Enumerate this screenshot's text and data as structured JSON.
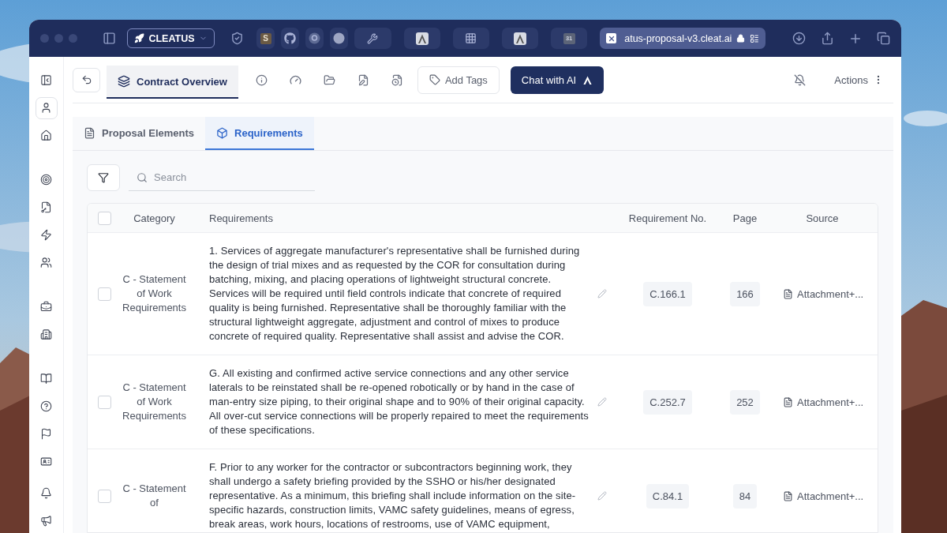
{
  "browser": {
    "profile": "CLEATUS",
    "tabs": [
      {
        "kind": "letter",
        "text": "S"
      },
      {
        "kind": "github"
      },
      {
        "kind": "p-circle"
      },
      {
        "kind": "dot"
      },
      {
        "kind": "tool"
      },
      {
        "kind": "logo"
      },
      {
        "kind": "grid"
      },
      {
        "kind": "logo"
      },
      {
        "kind": "calendar",
        "text": "31"
      }
    ],
    "address": "atus-proposal-v3.cleat.ai"
  },
  "sidebar": {
    "items": [
      {
        "kind": "panel",
        "selected": false
      },
      {
        "kind": "user",
        "selected": true
      },
      {
        "kind": "home",
        "selected": false
      },
      {
        "kind": "gap"
      },
      {
        "kind": "target",
        "selected": false
      },
      {
        "kind": "file-key",
        "selected": false
      },
      {
        "kind": "zap",
        "selected": false
      },
      {
        "kind": "users",
        "selected": false
      },
      {
        "kind": "gap"
      },
      {
        "kind": "briefcase",
        "selected": false
      },
      {
        "kind": "building",
        "selected": false
      },
      {
        "kind": "gap"
      },
      {
        "kind": "book",
        "selected": false
      },
      {
        "kind": "help",
        "selected": false
      },
      {
        "kind": "flag",
        "selected": false
      },
      {
        "kind": "card",
        "selected": false
      }
    ],
    "bottom": [
      {
        "kind": "bell",
        "selected": false
      },
      {
        "kind": "megaphone",
        "selected": false
      }
    ]
  },
  "toolbar": {
    "tabs": [
      {
        "label": "Contract Overview",
        "selected": true
      }
    ],
    "icons": [
      {
        "kind": "info"
      },
      {
        "kind": "gauge"
      },
      {
        "kind": "folder"
      },
      {
        "kind": "file-pen"
      },
      {
        "kind": "file-clock"
      }
    ],
    "add_tags": "Add Tags",
    "chat": "Chat with AI",
    "actions": "Actions"
  },
  "subtabs": [
    {
      "label": "Proposal Elements",
      "selected": false
    },
    {
      "label": "Requirements",
      "selected": true
    }
  ],
  "search": {
    "placeholder": "Search"
  },
  "table": {
    "header_checked": false,
    "columns": [
      "Category",
      "Requirements",
      "Requirement No.",
      "Page",
      "Source"
    ],
    "rows": [
      {
        "checked": false,
        "category": "C - Statement of Work Requirements",
        "requirement": "1. Services of aggregate manufacturer's representative shall be furnished during the design of trial mixes and as requested by the COR for consultation during batching, mixing, and placing operations of lightweight structural concrete. Services will be required until field controls indicate that concrete of required quality is being furnished. Representative shall be thoroughly familiar with the structural lightweight aggregate, adjustment and control of mixes to produce concrete of required quality. Representative shall assist and advise the COR.",
        "number": "C.166.1",
        "page": "166",
        "source": "Attachment+..."
      },
      {
        "checked": false,
        "category": "C - Statement of Work Requirements",
        "requirement": "G. All existing and confirmed active service connections and any other service laterals to be reinstated shall be re-opened robotically or by hand in the case of man-entry size piping, to their original shape and to 90% of their original capacity. All over-cut service connections will be properly repaired to meet the requirements of these specifications.",
        "number": "C.252.7",
        "page": "252",
        "source": "Attachment+..."
      },
      {
        "checked": false,
        "category": "C - Statement of",
        "requirement": "F. Prior to any worker for the contractor or subcontractors beginning work, they shall undergo a safety briefing provided by the SSHO or his/her designated representative. As a minimum, this briefing shall include information on the site-specific hazards, construction limits, VAMC safety guidelines, means of egress, break areas, work hours, locations of restrooms, use of VAMC equipment,",
        "number": "C.84.1",
        "page": "84",
        "source": "Attachment+..."
      }
    ]
  }
}
